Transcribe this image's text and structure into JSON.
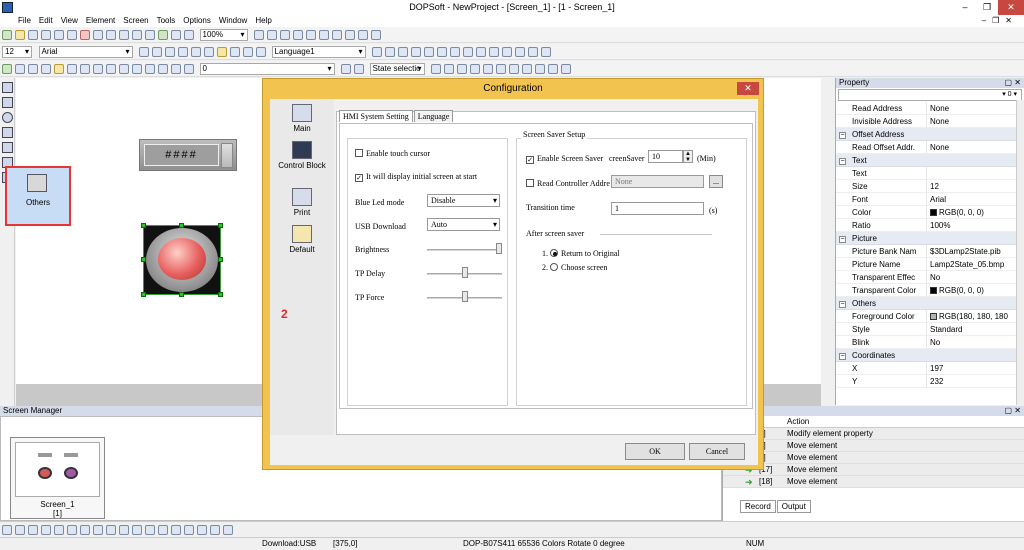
{
  "window": {
    "title": "DOPSoft - NewProject - [Screen_1] - [1 - Screen_1]",
    "min": "–",
    "max": "❐",
    "close": "✕",
    "sub_min": "–",
    "sub_max": "❐",
    "sub_close": "✕"
  },
  "menu": [
    "File",
    "Edit",
    "View",
    "Element",
    "Screen",
    "Tools",
    "Options",
    "Window",
    "Help"
  ],
  "toolbar": {
    "zoom": "100%",
    "font_size": "12",
    "font_name": "Arial",
    "language": "Language1",
    "state_value": "0",
    "state_selection": "State selectio"
  },
  "canvas": {
    "display_text": "####"
  },
  "dialog": {
    "title": "Configuration",
    "close": "✕",
    "nav": [
      {
        "label": "Main"
      },
      {
        "label": "Control Block"
      },
      {
        "label": "Print"
      },
      {
        "label": "Default"
      },
      {
        "label": "Others"
      }
    ],
    "annotation": "2",
    "tabs": [
      "HMI System Setting",
      "Language"
    ],
    "left": {
      "enable_touch_cursor": "Enable touch cursor",
      "display_initial_screen": "It will display initial screen at start",
      "blue_led_label": "Blue Led mode",
      "blue_led_value": "Disable",
      "usb_download_label": "USB Download",
      "usb_download_value": "Auto",
      "brightness_label": "Brightness",
      "tp_delay_label": "TP Delay",
      "tp_force_label": "TP Force"
    },
    "right": {
      "group_title": "Screen Saver Setup",
      "enable_screen_saver": "Enable Screen Saver",
      "screen_saver_label": "creenSaver",
      "screen_saver_value": "10",
      "screen_saver_unit": "(Min)",
      "read_controller": "Read Controller Addre",
      "read_controller_value": "None",
      "browse": "...",
      "transition_label": "Transition time",
      "transition_value": "1",
      "transition_unit": "(s)",
      "after_label": "After screen saver",
      "option1_num": "1.",
      "option1": "Return to Original",
      "option2_num": "2.",
      "option2": "Choose screen"
    },
    "ok": "OK",
    "cancel": "Cancel"
  },
  "property": {
    "title": "Property",
    "combo_value": "0",
    "rows": [
      {
        "type": "row",
        "label": "Read Address",
        "value": "None"
      },
      {
        "type": "row",
        "label": "Invisible Address",
        "value": "None"
      },
      {
        "type": "cat",
        "label": "Offset Address"
      },
      {
        "type": "row",
        "label": "Read Offset Addr.",
        "value": "None"
      },
      {
        "type": "cat",
        "label": "Text"
      },
      {
        "type": "row",
        "label": "Text",
        "value": ""
      },
      {
        "type": "row",
        "label": "Size",
        "value": "12"
      },
      {
        "type": "row",
        "label": "Font",
        "value": "Arial"
      },
      {
        "type": "row",
        "label": "Color",
        "value": "RGB(0, 0, 0)",
        "swatch": "#000000"
      },
      {
        "type": "row",
        "label": "Ratio",
        "value": "100%"
      },
      {
        "type": "cat",
        "label": "Picture"
      },
      {
        "type": "row",
        "label": "Picture Bank Nam",
        "value": "$3DLamp2State.pib"
      },
      {
        "type": "row",
        "label": "Picture Name",
        "value": "Lamp2State_05.bmp"
      },
      {
        "type": "row",
        "label": "Transparent Effec",
        "value": "No"
      },
      {
        "type": "row",
        "label": "Transparent Color",
        "value": "RGB(0, 0, 0)",
        "swatch": "#000000"
      },
      {
        "type": "cat",
        "label": "Others"
      },
      {
        "type": "row",
        "label": "Foreground Color",
        "value": "RGB(180, 180, 180",
        "swatch": "#b4b4b4"
      },
      {
        "type": "row",
        "label": "Style",
        "value": "Standard"
      },
      {
        "type": "row",
        "label": "Blink",
        "value": "No"
      },
      {
        "type": "cat",
        "label": "Coordinates"
      },
      {
        "type": "row",
        "label": "X",
        "value": "197"
      },
      {
        "type": "row",
        "label": "Y",
        "value": "232"
      }
    ]
  },
  "screen_manager": {
    "title": "Screen Manager",
    "screen_name": "Screen_1",
    "screen_number": "[1]"
  },
  "history": {
    "column": "Action",
    "rows": [
      {
        "id": "4]",
        "action": "Modify element property",
        "arrow": false
      },
      {
        "id": "5]",
        "action": "Move element",
        "arrow": false
      },
      {
        "id": "6]",
        "action": "Move element",
        "arrow": false
      },
      {
        "id": "[17]",
        "action": "Move element",
        "arrow": true
      },
      {
        "id": "[18]",
        "action": "Move element",
        "arrow": true
      }
    ],
    "tabs": [
      "Record",
      "Output"
    ]
  },
  "status": {
    "download": "Download:USB",
    "coords": "[375,0]",
    "device": "DOP-B07S411 65536 Colors Rotate 0 degree",
    "num": "NUM"
  }
}
